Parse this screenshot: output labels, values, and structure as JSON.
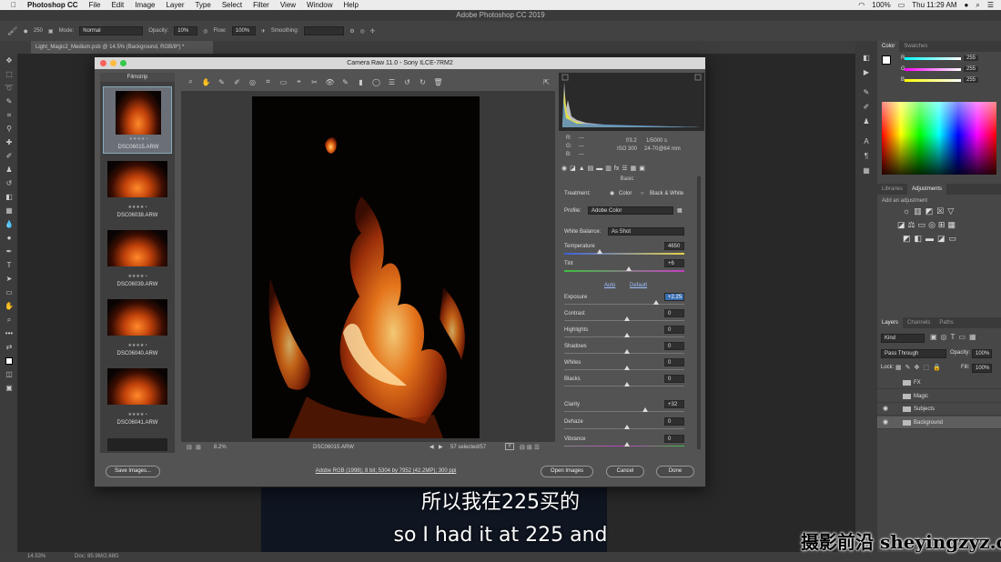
{
  "menubar": {
    "apple": "",
    "app": "Photoshop CC",
    "items": [
      "File",
      "Edit",
      "Image",
      "Layer",
      "Type",
      "Select",
      "Filter",
      "View",
      "Window",
      "Help"
    ],
    "battery": "100%",
    "clock": "Thu 11:29 AM"
  },
  "window_title": "Adobe Photoshop CC 2019",
  "options": {
    "brush_size": "250",
    "mode_label": "Mode:",
    "mode_value": "Normal",
    "opacity_label": "Opacity:",
    "opacity_value": "10%",
    "flow_label": "Flow:",
    "flow_value": "100%",
    "smoothing_label": "Smoothing:"
  },
  "doc_tab": "Light_Magic2_Medium.psb @ 14.5% (Background, RGB/8*) *",
  "status": {
    "zoom": "14.53%",
    "doc": "Doc: 85.9M/2.68G"
  },
  "color_panel": {
    "tabs": [
      "Color",
      "Swatches"
    ],
    "r_label": "R",
    "r_value": "255",
    "g_label": "G",
    "g_value": "255",
    "b_label": "B",
    "b_value": "255"
  },
  "adjustments_panel": {
    "tabs": [
      "Libraries",
      "Adjustments"
    ],
    "hint": "Add an adjustment"
  },
  "layers_panel": {
    "tabs": [
      "Layers",
      "Channels",
      "Paths"
    ],
    "kind": "Kind",
    "blend": "Pass Through",
    "opacity_label": "Opacity:",
    "opacity_value": "100%",
    "lock_label": "Lock:",
    "fill_label": "Fill:",
    "fill_value": "100%",
    "layers": [
      "FX",
      "Magic",
      "Subjects",
      "Background"
    ]
  },
  "camera_raw": {
    "title": "Camera Raw 11.0  -  Sony ILCE-7RM2",
    "filmstrip_title": "Filmstrip",
    "thumbs": [
      {
        "name": "DSC06015.ARW",
        "stars": "★★★★ •"
      },
      {
        "name": "DSC06038.ARW",
        "stars": "★★★★ •"
      },
      {
        "name": "DSC06039.ARW",
        "stars": "★★★★ •"
      },
      {
        "name": "DSC06040.ARW",
        "stars": "★★★★ •"
      },
      {
        "name": "DSC06041.ARW",
        "stars": "★★★★ •"
      }
    ],
    "zoom": "8.2%",
    "filename": "DSC06015.ARW",
    "selected": "57 selected/57",
    "camera": {
      "r": "R:",
      "g": "G:",
      "b": "B:",
      "dashes": "---",
      "aperture": "f/3.2",
      "shutter": "1/5000 s",
      "iso": "ISO 300",
      "lens": "24-70@64 mm"
    },
    "panel_name": "Basic",
    "treatment_label": "Treatment:",
    "treatment_color": "Color",
    "treatment_bw": "Black & White",
    "profile_label": "Profile:",
    "profile_value": "Adobe Color",
    "wb_label": "White Balance:",
    "wb_value": "As Shot",
    "auto": "Auto",
    "default": "Default",
    "sliders": [
      {
        "label": "Temperature",
        "value": "4650"
      },
      {
        "label": "Tint",
        "value": "+6"
      },
      {
        "label": "Exposure",
        "value": "+2.25"
      },
      {
        "label": "Contrast",
        "value": "0"
      },
      {
        "label": "Highlights",
        "value": "0"
      },
      {
        "label": "Shadows",
        "value": "0"
      },
      {
        "label": "Whites",
        "value": "0"
      },
      {
        "label": "Blacks",
        "value": "0"
      },
      {
        "label": "Clarity",
        "value": "+32"
      },
      {
        "label": "Dehaze",
        "value": "0"
      },
      {
        "label": "Vibrance",
        "value": "0"
      }
    ],
    "save_button": "Save Images...",
    "info_link": "Adobe RGB (1998); 8 bit; 5304 by 7952 (42.2MP); 300 ppi",
    "open_button": "Open Images",
    "cancel_button": "Cancel",
    "done_button": "Done"
  },
  "subtitles": {
    "zh": "所以我在225买的",
    "en": "so I had it at 225 and"
  },
  "watermark": "摄影前沿 sheyingzyz.com"
}
